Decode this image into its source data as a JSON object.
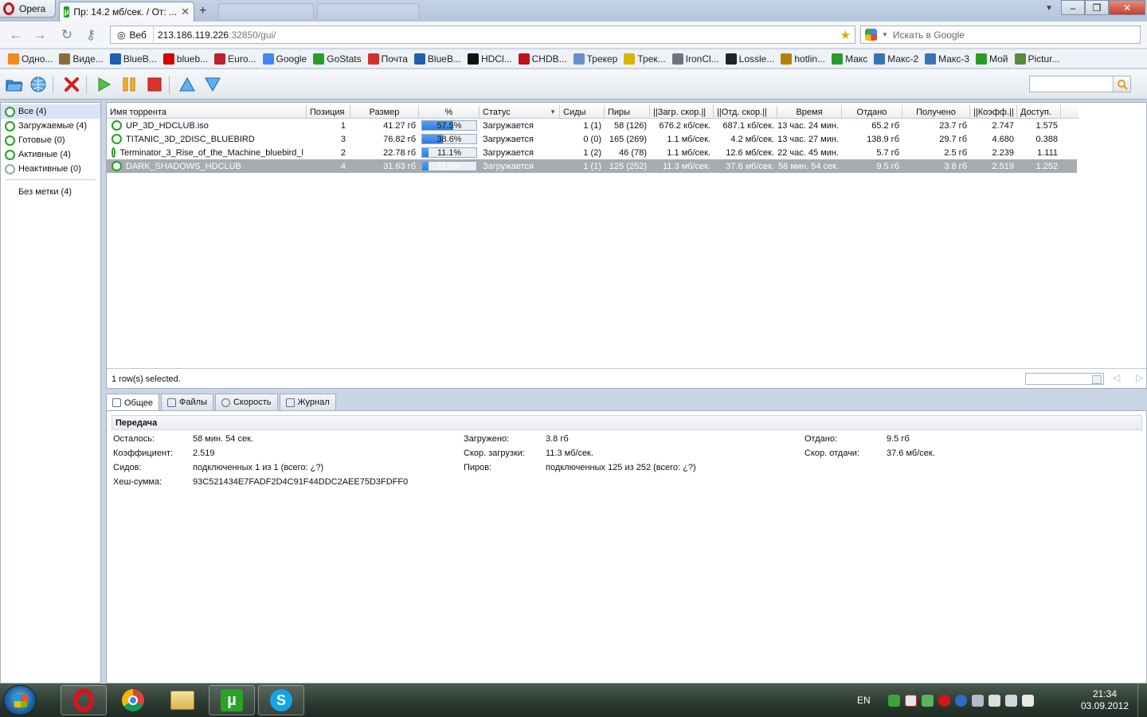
{
  "browser": {
    "menu_label": "Opera",
    "tab_title": "Пр: 14.2 мб/сек. / От: ...",
    "address": {
      "badge": "Веб",
      "host": "213.186.119.226",
      "port": ":32850/gui/"
    },
    "search_placeholder": "Искать в Google"
  },
  "bookmarks": [
    {
      "label": "Одно...",
      "color": "#f08a1c"
    },
    {
      "label": "Виде...",
      "color": "#8a6d3b"
    },
    {
      "label": "BlueB...",
      "color": "#1f5fae"
    },
    {
      "label": "blueb...",
      "color": "#d40000"
    },
    {
      "label": "Euro...",
      "color": "#c0202a"
    },
    {
      "label": "Google",
      "color": "#4285f4"
    },
    {
      "label": "GoStats",
      "color": "#2a9c2a"
    },
    {
      "label": "Почта",
      "color": "#d0312d"
    },
    {
      "label": "BlueB...",
      "color": "#1f5fae"
    },
    {
      "label": "HDCl...",
      "color": "#111111"
    },
    {
      "label": "CHDB...",
      "color": "#c0101a"
    },
    {
      "label": "Трекер",
      "color": "#6a8fcf"
    },
    {
      "label": "Трек...",
      "color": "#d6b400"
    },
    {
      "label": "IronCl...",
      "color": "#6d7580"
    },
    {
      "label": "Lossle...",
      "color": "#222222"
    },
    {
      "label": "hotlin...",
      "color": "#b38200"
    },
    {
      "label": "Макс",
      "color": "#2a9c2a"
    },
    {
      "label": "Макс-2",
      "color": "#3a73b8"
    },
    {
      "label": "Макс-3",
      "color": "#3a73b8"
    },
    {
      "label": "Мой",
      "color": "#2a9c2a"
    },
    {
      "label": "Pictur...",
      "color": "#5a8a3a"
    }
  ],
  "sidebar": {
    "categories": [
      {
        "label": "Все (4)",
        "selected": true,
        "status": "active"
      },
      {
        "label": "Загружаемые (4)",
        "selected": false,
        "status": "active"
      },
      {
        "label": "Готовые (0)",
        "selected": false,
        "status": "active"
      },
      {
        "label": "Активные (4)",
        "selected": false,
        "status": "active"
      },
      {
        "label": "Неактивные (0)",
        "selected": false,
        "status": "inactive"
      }
    ],
    "labels": [
      {
        "label": "Без метки (4)"
      }
    ]
  },
  "torrents": {
    "columns": [
      "Имя торрента",
      "Позиция",
      "Размер",
      "%",
      "Статус",
      "Сиды",
      "Пиры",
      "||Загр. скор.||",
      "||Отд. скор.||",
      "Время",
      "Отдано",
      "Получено",
      "||Коэфф.||",
      "Доступ."
    ],
    "rows": [
      {
        "name": "UP_3D_HDCLUB.iso",
        "pos": "1",
        "size": "41.27 гб",
        "pct_label": "57.5%",
        "pct": 57.5,
        "status": "Загружается",
        "seeds": "1 (1)",
        "peers": "58 (126)",
        "down": "676.2 кб/сек.",
        "up": "687.1 кб/сек.",
        "eta": "13 час. 24 мин.",
        "uploaded": "65.2 гб",
        "downloaded": "23.7 гб",
        "ratio": "2.747",
        "avail": "1.575",
        "selected": false
      },
      {
        "name": "TITANIC_3D_2DISC_BLUEBIRD",
        "pos": "3",
        "size": "76.82 гб",
        "pct_label": "38.6%",
        "pct": 38.6,
        "status": "Загружается",
        "seeds": "0 (0)",
        "peers": "165 (269)",
        "down": "1.1 мб/сек.",
        "up": "4.2 мб/сек.",
        "eta": "13 час. 27 мин.",
        "uploaded": "138.9 гб",
        "downloaded": "29.7 гб",
        "ratio": "4.680",
        "avail": "0.388",
        "selected": false
      },
      {
        "name": "Terminator_3_Rise_of_the_Machine_bluebird_l",
        "pos": "2",
        "size": "22.78 гб",
        "pct_label": "11.1%",
        "pct": 11.1,
        "status": "Загружается",
        "seeds": "1 (2)",
        "peers": "46 (78)",
        "down": "1.1 мб/сек.",
        "up": "12.6 мб/сек.",
        "eta": "22 час. 45 мин.",
        "uploaded": "5.7 гб",
        "downloaded": "2.5 гб",
        "ratio": "2.239",
        "avail": "1.111",
        "selected": false
      },
      {
        "name": "DARK_SHADOWS_HDCLUB",
        "pos": "4",
        "size": "31.63 гб",
        "pct_label": "11.9%",
        "pct": 11.9,
        "status": "Загружается",
        "seeds": "1 (1)",
        "peers": "125 (252)",
        "down": "11.3 мб/сек.",
        "up": "37.6 мб/сек.",
        "eta": "58 мин. 54 сек.",
        "uploaded": "9.5 гб",
        "downloaded": "3.8 гб",
        "ratio": "2.519",
        "avail": "1.252",
        "selected": true
      }
    ],
    "status_text": "1 row(s) selected."
  },
  "details": {
    "tabs": [
      "Общее",
      "Файлы",
      "Скорость",
      "Журнал"
    ],
    "section_title": "Передача",
    "left": [
      {
        "k": "Осталось:",
        "v": "58 мин. 54 сек."
      },
      {
        "k": "Коэффициент:",
        "v": "2.519"
      },
      {
        "k": "Сидов:",
        "v": "подключенных 1 из 1 (всего: ¿?)"
      },
      {
        "k": "Хеш-сумма:",
        "v": "93C521434E7FADF2D4C91F44DDC2AEE75D3FDFF0"
      }
    ],
    "middle": [
      {
        "k": "Загружено:",
        "v": "3.8 гб"
      },
      {
        "k": "Скор. загрузки:",
        "v": "11.3 мб/сек."
      },
      {
        "k": "Пиров:",
        "v": "подключенных 125 из 252 (всего: ¿?)"
      }
    ],
    "right": [
      {
        "k": "Отдано:",
        "v": "9.5 гб"
      },
      {
        "k": "Скор. отдачи:",
        "v": "37.6 мб/сек."
      }
    ]
  },
  "taskbar": {
    "lang": "EN",
    "time": "21:34",
    "date": "03.09.2012"
  }
}
